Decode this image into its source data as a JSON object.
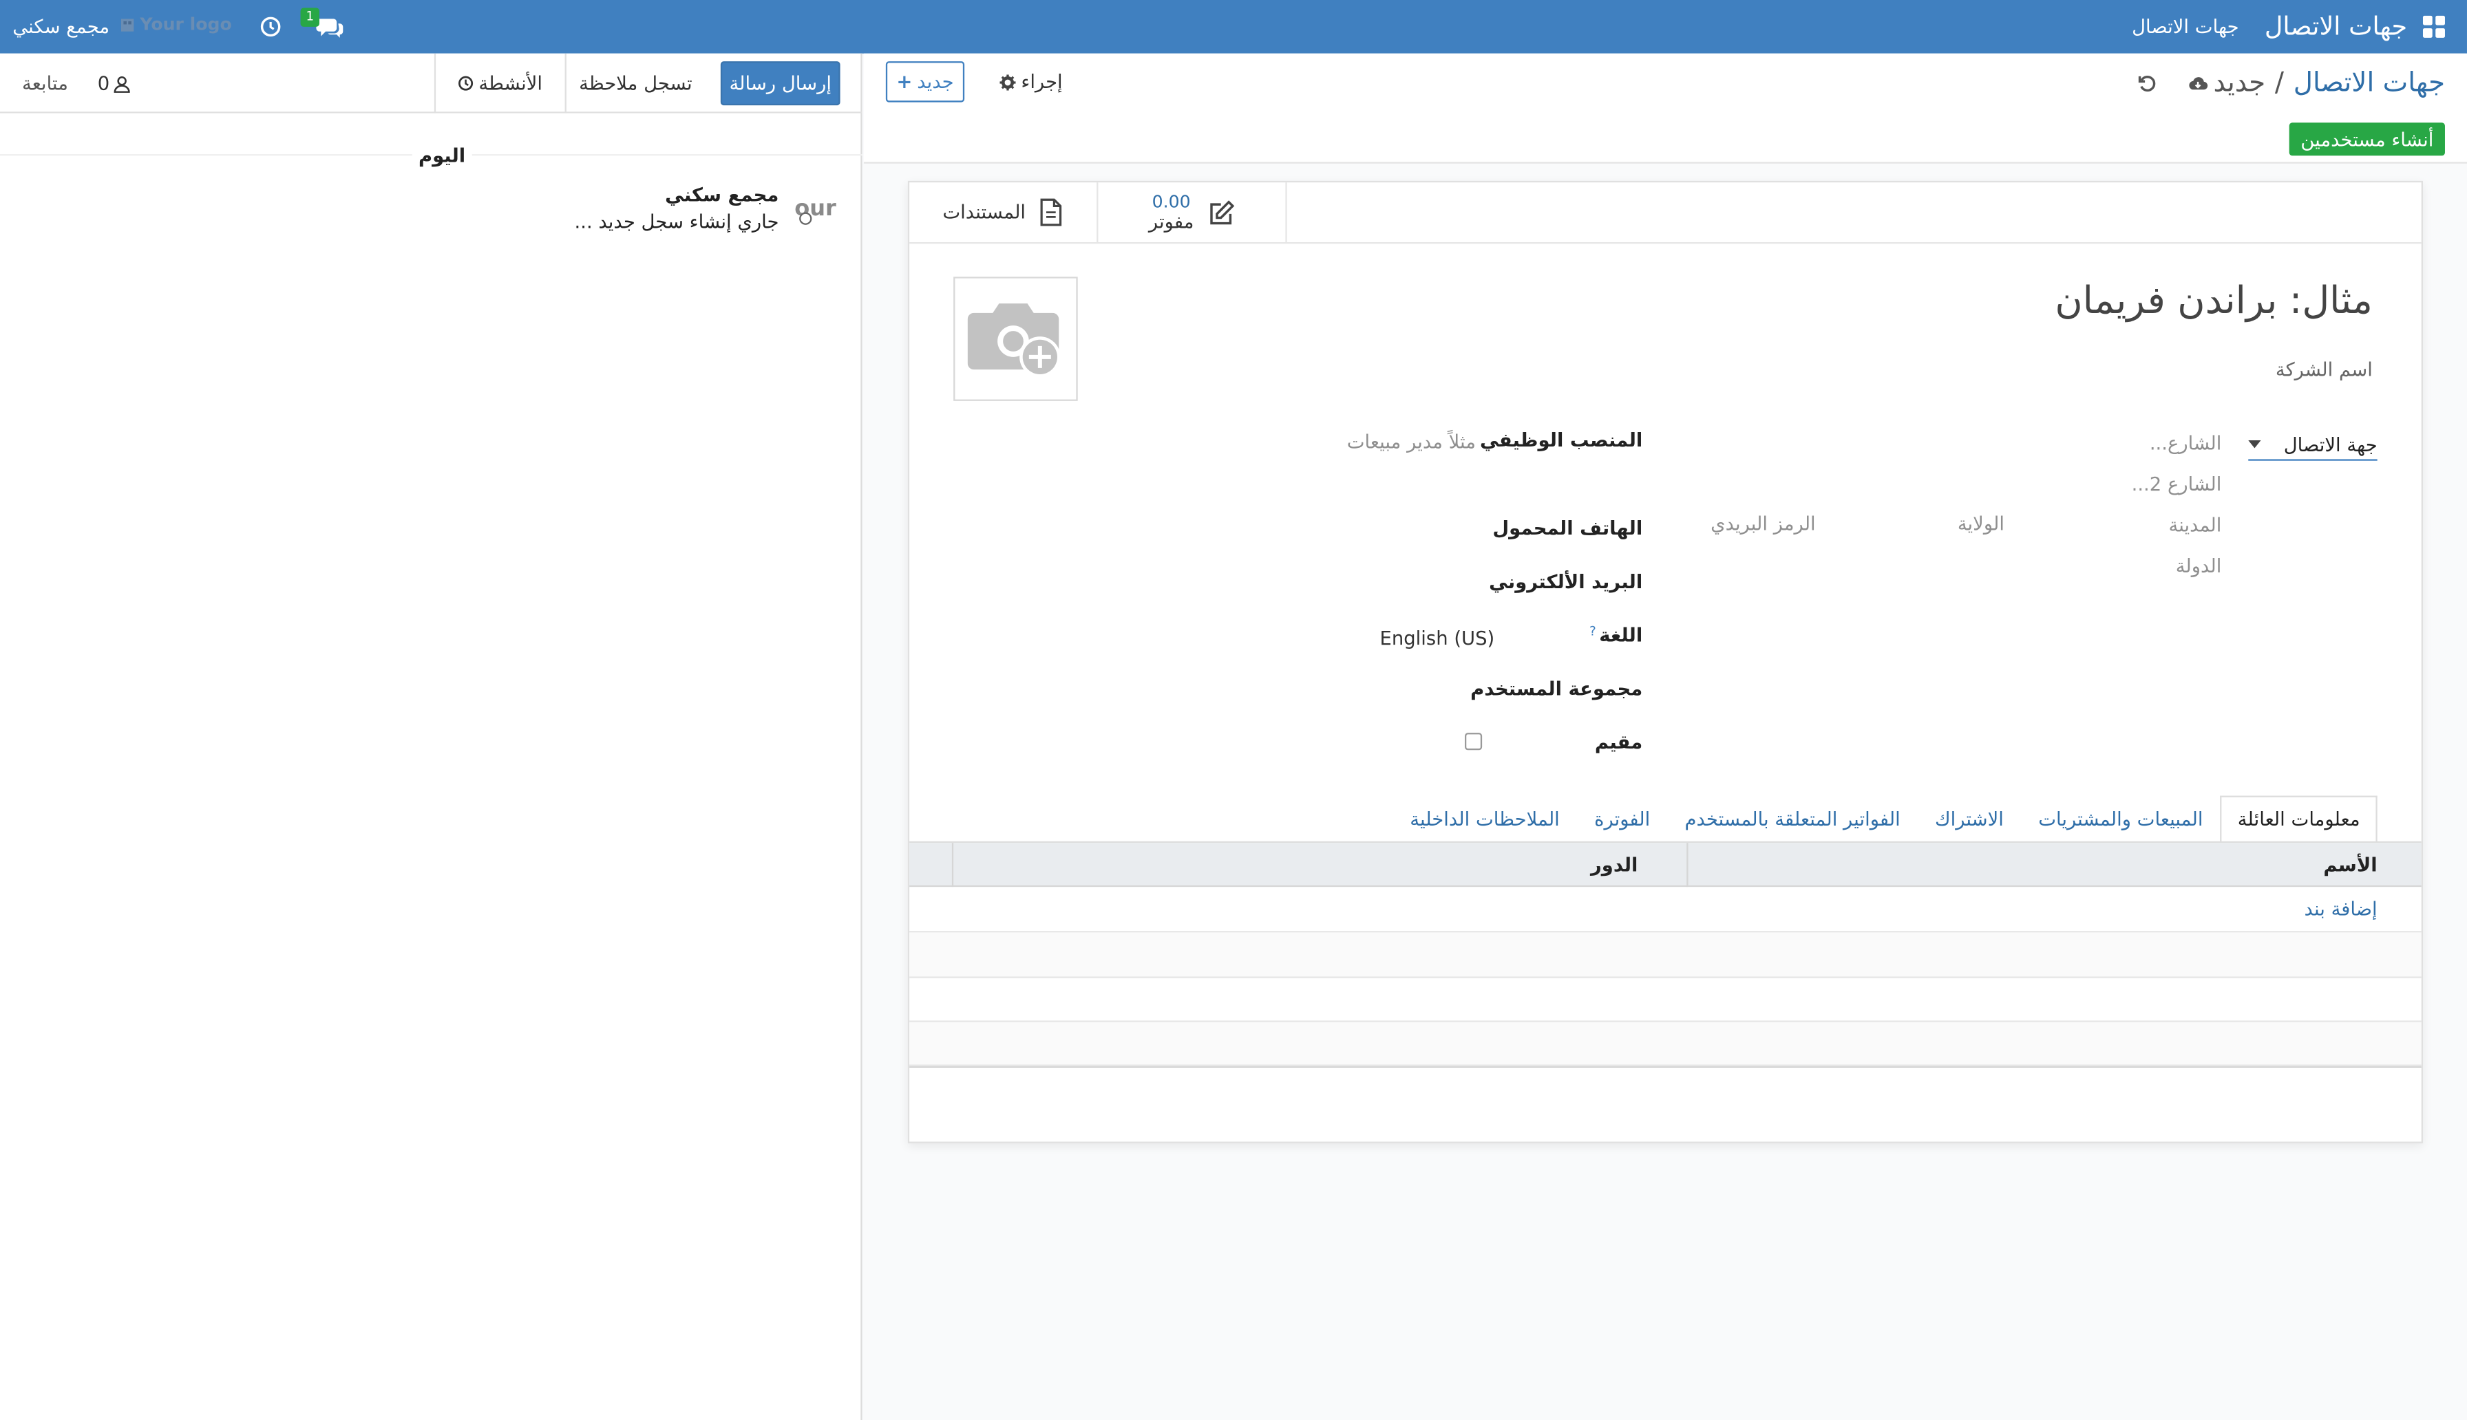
{
  "navbar": {
    "app_title": "جهات الاتصال",
    "menu_contacts": "جهات الاتصال",
    "messages_badge": "1",
    "company_logo": "Your logo",
    "company_name": "مجمع سكني",
    "bg_color": "#4080c0"
  },
  "breadcrumb": {
    "parent": "جهات الاتصال",
    "separator": "/",
    "current": "جديد"
  },
  "control": {
    "action_label": "إجراء",
    "new_label": "جديد",
    "create_users_label": "أنشاء مستخدمين"
  },
  "stat_buttons": {
    "documents_label": "المستندات",
    "invoiced_value": "0.00",
    "invoiced_label": "مفوتر"
  },
  "form": {
    "name_placeholder": "مثال: براندن فريمان",
    "company_placeholder": "اسم الشركة",
    "address_type": "جهة الاتصال",
    "street_placeholder": "الشارع...",
    "street2_placeholder": "الشارع 2...",
    "city_placeholder": "المدينة",
    "state_placeholder": "الولاية",
    "zip_placeholder": "الرمز البريدي",
    "country_placeholder": "الدولة",
    "job_position_label": "المنصب الوظيفي",
    "job_position_placeholder": "مثلاً مدير مبيعات",
    "mobile_label": "الهاتف المحمول",
    "email_label": "البريد الألكتروني",
    "language_label": "اللغة",
    "language_help": "?",
    "language_value": "English (US)",
    "user_group_label": "مجموعة المستخدم",
    "resident_label": "مقيم"
  },
  "tabs": [
    "معلومات العائلة",
    "المبيعات والمشتريات",
    "الاشتراك",
    "الفواتير المتعلقة بالمستخدم",
    "الفوترة",
    "الملاحظات الداخلية"
  ],
  "family_table": {
    "col_name": "الأسم",
    "col_role": "الدور",
    "add_line": "إضافة بند"
  },
  "chatter": {
    "send_message": "إرسال رسالة",
    "log_note": "تسجل ملاحظة",
    "activities": "الأنشطة",
    "followers_count": "0",
    "follow": "متابعة",
    "date_separator": "اليوم",
    "message_author": "مجمع سكني",
    "message_body": "جاري إنشاء سجل جديد ...",
    "avatar_text": "our"
  }
}
